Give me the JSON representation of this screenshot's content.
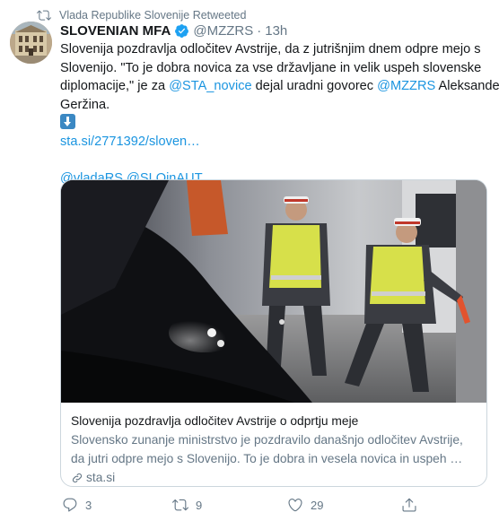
{
  "retweet": {
    "icon": "retweet-icon",
    "text": "Vlada Republike Slovenije Retweeted"
  },
  "author": {
    "name": "SLOVENIAN MFA",
    "verified_icon": "verified-badge-icon",
    "handle": "@MZZRS",
    "separator": "·",
    "time": "13h"
  },
  "tweet": {
    "line1": "Slovenija pozdravlja odločitev Avstrije, da z jutrišnjim dnem odpre mejo s",
    "line2": "Slovenijo. \"To je dobra novica za vse državljane in velik uspeh slovenske",
    "line3_pre": "diplomacije,\" je za ",
    "mention_sta": "@STA_novice",
    "line3_mid": " dejal uradni govorec ",
    "mention_mzzrs": "@MZZRS",
    "line3_post": " Aleksander",
    "line4": "Geržina.",
    "arrow_icon": "down-arrow-emoji",
    "link": "sta.si/2771392/sloven…",
    "mention_vlada": "@vladaRS",
    "mention_sloinaut": "@SLOinAUT"
  },
  "card": {
    "image_alt": "police-officers-at-border",
    "title": "Slovenija pozdravlja odločitev Avstrije o odprtju meje",
    "desc_line1": "Slovensko zunanje ministrstvo je pozdravilo današnjo odločitev Avstrije,",
    "desc_line2": "da jutri odpre mejo s Slovenijo. To je dobra in vesela novica in uspeh …",
    "domain": "sta.si"
  },
  "actions": {
    "reply_count": "3",
    "retweet_count": "9",
    "like_count": "29",
    "share_count": ""
  },
  "colors": {
    "link": "#1b95e0",
    "muted": "#657786",
    "text": "#14171a",
    "verified": "#1da1f2",
    "border": "#ccd6dd"
  }
}
